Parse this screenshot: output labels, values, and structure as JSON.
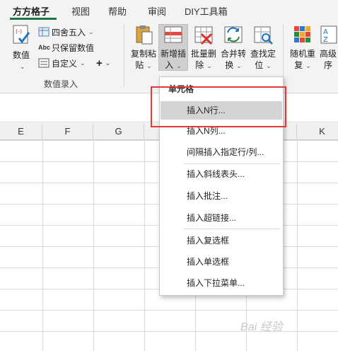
{
  "tabs": [
    "方方格子",
    "视图",
    "帮助",
    "审阅",
    "DIY工具箱"
  ],
  "ribbon": {
    "numeric": {
      "label": "数值"
    },
    "round": {
      "label": "四舍五入"
    },
    "keep_value": {
      "label": "只保留数值"
    },
    "custom": {
      "label": "自定义"
    },
    "plus": {
      "label": "+"
    },
    "group_label": "数值录入",
    "copy_paste": {
      "line1": "复制粘",
      "line2": "贴"
    },
    "insert_new": {
      "line1": "新增插",
      "line2": "入"
    },
    "batch_delete": {
      "line1": "批量删",
      "line2": "除"
    },
    "merge_convert": {
      "line1": "合并转",
      "line2": "换"
    },
    "find_locate": {
      "line1": "查找定",
      "line2": "位"
    },
    "random_dup": {
      "line1": "随机重",
      "line2": "复"
    },
    "advanced": {
      "line1": "高级",
      "line2": "序"
    }
  },
  "columns": [
    "E",
    "F",
    "G",
    "K"
  ],
  "menu": {
    "header": "单元格",
    "items": [
      "插入N行...",
      "插入N列...",
      "间隔插入指定行/列...",
      "插入斜线表头...",
      "插入批注...",
      "插入超链接...",
      "插入复选框",
      "插入单选框",
      "插入下拉菜单..."
    ]
  },
  "watermark": "Bai 经验",
  "colors": {
    "accent": "#217346",
    "highlight": "#e53935"
  }
}
